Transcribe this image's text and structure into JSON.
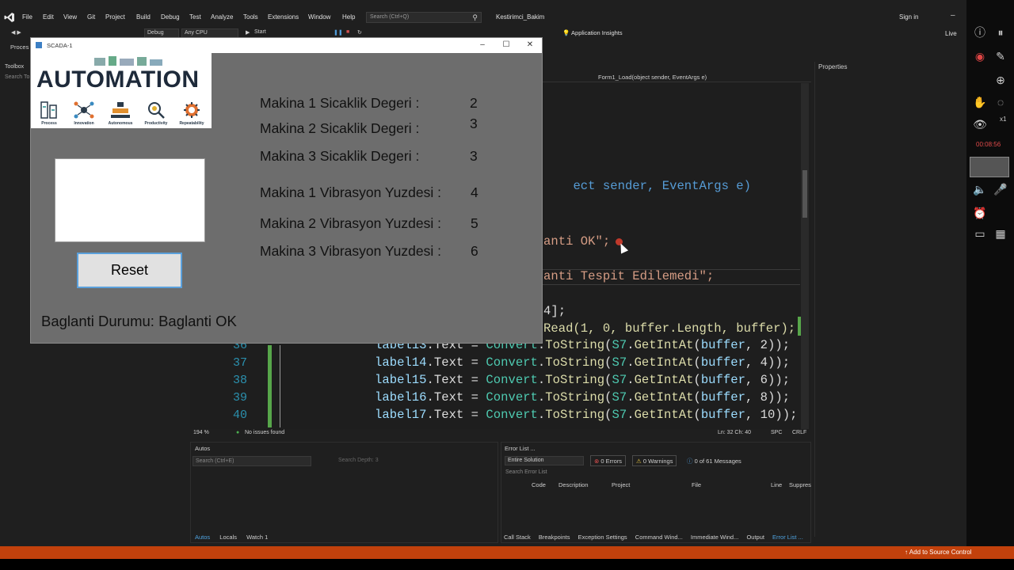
{
  "vs": {
    "menus": [
      "File",
      "Edit",
      "View",
      "Git",
      "Project",
      "Build",
      "Debug",
      "Test",
      "Analyze",
      "Tools",
      "Extensions",
      "Window",
      "Help"
    ],
    "search_placeholder": "Search (Ctrl+Q)",
    "solution_name": "Kestirimci_Bakim",
    "sign_in": "Sign in",
    "toolbar": {
      "config": "Debug",
      "platform": "Any CPU",
      "start": "Start",
      "app_insights": "Application Insights",
      "live": "Live"
    },
    "toolbox": "Toolbox",
    "search_toolbox": "Search To",
    "process": "Proces",
    "properties": "Properties",
    "nav_member": "Form1_Load(object sender, EventArgs e)",
    "code_fragments": {
      "line_a": "ect sender, EventArgs e)",
      "line_b": "anti OK\";",
      "line_c": "anti Tespit Edilemedi\";",
      "line_d": "4];",
      "line_e": "Read(1, 0, buffer.Length, buffer);"
    },
    "code_lines": [
      {
        "num": "36",
        "label": "label13",
        "offset": "2"
      },
      {
        "num": "37",
        "label": "label14",
        "offset": "4"
      },
      {
        "num": "38",
        "label": "label15",
        "offset": "6"
      },
      {
        "num": "39",
        "label": "label16",
        "offset": "8"
      },
      {
        "num": "40",
        "label": "label17",
        "offset": "10"
      }
    ],
    "status": {
      "zoom": "194 %",
      "issues": "No issues found",
      "position": "Ln: 32   Ch: 40",
      "spc": "SPC",
      "crlf": "CRLF"
    },
    "autos": {
      "title": "Autos",
      "search": "Search (Ctrl+E)",
      "depth_label": "Search Depth:",
      "depth_value": "3",
      "tabs": [
        "Autos",
        "Locals",
        "Watch 1"
      ]
    },
    "error_list": {
      "title": "Error List ...",
      "scope": "Entire Solution",
      "errors": "0 Errors",
      "warnings": "0 Warnings",
      "messages": "0 of 61 Messages",
      "search": "Search Error List",
      "columns": [
        "Code",
        "Description",
        "Project",
        "File",
        "Line",
        "Suppres"
      ]
    },
    "bottom_tabs": [
      "Call Stack",
      "Breakpoints",
      "Exception Settings",
      "Command Wind...",
      "Immediate Wind...",
      "Output",
      "Error List ..."
    ],
    "source_control": "Add to Source Control",
    "rail_timer": "00:08:56",
    "rail_x1": "x1"
  },
  "scada": {
    "title": "SCADA-1",
    "banner_word": "AUTOMATION",
    "banner_labels": [
      "Process",
      "Innovation",
      "Autonomous",
      "Productivity",
      "Repeatability"
    ],
    "reset_label": "Reset",
    "status_text": "Baglanti Durumu: Baglanti OK",
    "readings": [
      {
        "label": "Makina 1 Sicaklik Degeri :",
        "value": "2"
      },
      {
        "label": "Makina 2 Sicaklik Degeri :",
        "value": "3"
      },
      {
        "label": "Makina 3 Sicaklik Degeri :",
        "value": "3"
      },
      {
        "label": "Makina 1 Vibrasyon Yuzdesi :",
        "value": "4"
      },
      {
        "label": "Makina 2 Vibrasyon Yuzdesi :",
        "value": "5"
      },
      {
        "label": "Makina 3 Vibrasyon Yuzdesi :",
        "value": "6"
      }
    ]
  }
}
